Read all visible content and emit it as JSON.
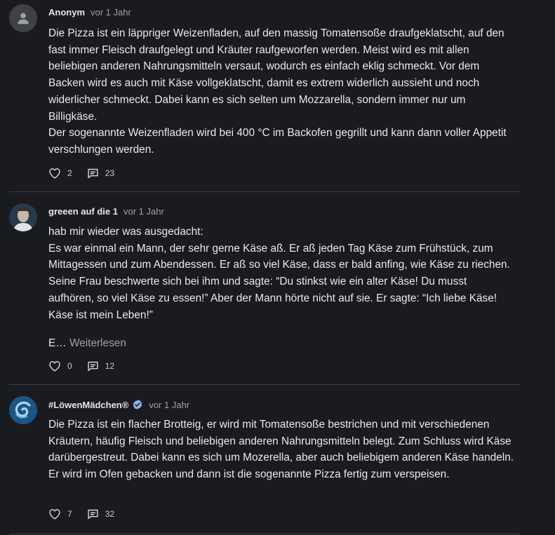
{
  "posts": [
    {
      "author": "Anonym",
      "time": "vor 1 Jahr",
      "lines": [
        "Die Pizza ist ein läppriger Weizenfladen, auf den massig Tomatensoße draufgeklatscht, auf den fast immer Fleisch draufgelegt und Kräuter raufgeworfen werden. Meist wird es mit allen beliebigen anderen Nahrungsmitteln versaut, wodurch es einfach eklig schmeckt. Vor dem Backen wird es auch mit Käse vollgeklatscht, damit es extrem widerlich aussieht und noch widerlicher schmeckt. Dabei kann es sich selten um Mozzarella, sondern immer nur um Billigkäse.",
        "Der sogenannte Weizenfladen wird bei 400 °C im Backofen gegrillt und kann dann voller Appetit verschlungen werden."
      ],
      "likes": "2",
      "comments": "23"
    },
    {
      "author": "greeen auf die 1",
      "time": "vor 1 Jahr",
      "lines": [
        "hab mir wieder was ausgedacht:",
        "Es war einmal ein Mann, der sehr gerne Käse aß. Er aß jeden Tag Käse zum Frühstück, zum Mittagessen und zum Abendessen. Er aß so viel Käse, dass er bald anfing, wie Käse zu riechen. Seine Frau beschwerte sich bei ihm und sagte: “Du stinkst wie ein alter Käse! Du musst aufhören, so viel Käse zu essen!” Aber der Mann hörte nicht auf sie. Er sagte: “Ich liebe Käse! Käse ist mein Leben!”"
      ],
      "truncated": "E…",
      "read_more": "Weiterlesen",
      "likes": "0",
      "comments": "12"
    },
    {
      "author": "#LöwenMädchen®",
      "time": "vor 1 Jahr",
      "lines": [
        "Die Pizza ist ein flacher Brotteig, er wird mit Tomatensoße bestrichen und mit verschiedenen Kräutern, häufig Fleisch und beliebigen anderen Nahrungsmitteln belegt. Zum Schluss wird Käse darübergestreut. Dabei kann es sich um Mozerella, aber auch beliebigem anderen Käse handeln. Er wird im Ofen gebacken und dann ist die sogenannte Pizza fertig zum verspeisen."
      ],
      "likes": "7",
      "comments": "32"
    }
  ],
  "colors": {
    "background": "#191b1f",
    "divider": "#3a3c41",
    "verified": "#8fb4e8"
  },
  "icons": [
    "user-icon",
    "heart-icon",
    "comment-icon",
    "verified-badge-icon"
  ]
}
